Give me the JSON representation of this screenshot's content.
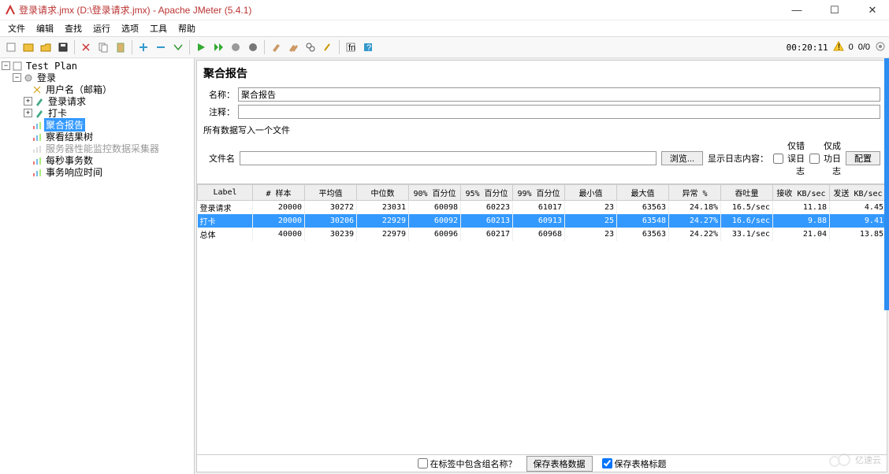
{
  "window": {
    "title": "登录请求.jmx (D:\\登录请求.jmx) - Apache JMeter (5.4.1)",
    "min": "—",
    "max": "☐",
    "close": "✕"
  },
  "menu": [
    "文件",
    "编辑",
    "查找",
    "运行",
    "选项",
    "工具",
    "帮助"
  ],
  "status": {
    "timer": "00:20:11",
    "warn": "0",
    "count": "0/0"
  },
  "tree": {
    "root": "Test Plan",
    "login": "登录",
    "user": "用户名（邮箱）",
    "req": "登录请求",
    "daka": "打卡",
    "agg": "聚合报告",
    "viewtree": "察看结果树",
    "perfmon": "服务器性能监控数据采集器",
    "tps": "每秒事务数",
    "resp": "事务响应时间"
  },
  "panel": {
    "title": "聚合报告",
    "name_lbl": "名称：",
    "name_val": "聚合报告",
    "comment_lbl": "注释：",
    "comment_val": "",
    "writeAll": "所有数据写入一个文件",
    "file_lbl": "文件名",
    "file_val": "",
    "browse": "浏览...",
    "logLbl": "显示日志内容：",
    "errOnly": "仅错误日志",
    "okOnly": "仅成功日志",
    "config": "配置"
  },
  "table": {
    "headers": [
      "Label",
      "# 样本",
      "平均值",
      "中位数",
      "90% 百分位",
      "95% 百分位",
      "99% 百分位",
      "最小值",
      "最大值",
      "异常 %",
      "吞吐量",
      "接收 KB/sec",
      "发送 KB/sec"
    ],
    "rows": [
      {
        "c": [
          "登录请求",
          "20000",
          "30272",
          "23031",
          "60098",
          "60223",
          "61017",
          "23",
          "63563",
          "24.18%",
          "16.5/sec",
          "11.18",
          "4.45"
        ],
        "sel": false
      },
      {
        "c": [
          "打卡",
          "20000",
          "30206",
          "22929",
          "60092",
          "60213",
          "60913",
          "25",
          "63548",
          "24.27%",
          "16.6/sec",
          "9.88",
          "9.41"
        ],
        "sel": true
      },
      {
        "c": [
          "总体",
          "40000",
          "30239",
          "22979",
          "60096",
          "60217",
          "60968",
          "23",
          "63563",
          "24.22%",
          "33.1/sec",
          "21.04",
          "13.85"
        ],
        "sel": false
      }
    ]
  },
  "bottom": {
    "groupChk": "在标签中包含组名称？",
    "saveData": "保存表格数据",
    "saveHeader": "保存表格标题"
  },
  "watermark": "亿速云",
  "chart_data": {
    "type": "table",
    "title": "聚合报告",
    "columns": [
      "Label",
      "# 样本",
      "平均值",
      "中位数",
      "90% 百分位",
      "95% 百分位",
      "99% 百分位",
      "最小值",
      "最大值",
      "异常 %",
      "吞吐量",
      "接收 KB/sec",
      "发送 KB/sec"
    ],
    "rows": [
      [
        "登录请求",
        20000,
        30272,
        23031,
        60098,
        60223,
        61017,
        23,
        63563,
        "24.18%",
        "16.5/sec",
        11.18,
        4.45
      ],
      [
        "打卡",
        20000,
        30206,
        22929,
        60092,
        60213,
        60913,
        25,
        63548,
        "24.27%",
        "16.6/sec",
        9.88,
        9.41
      ],
      [
        "总体",
        40000,
        30239,
        22979,
        60096,
        60217,
        60968,
        23,
        63563,
        "24.22%",
        "33.1/sec",
        21.04,
        13.85
      ]
    ]
  }
}
